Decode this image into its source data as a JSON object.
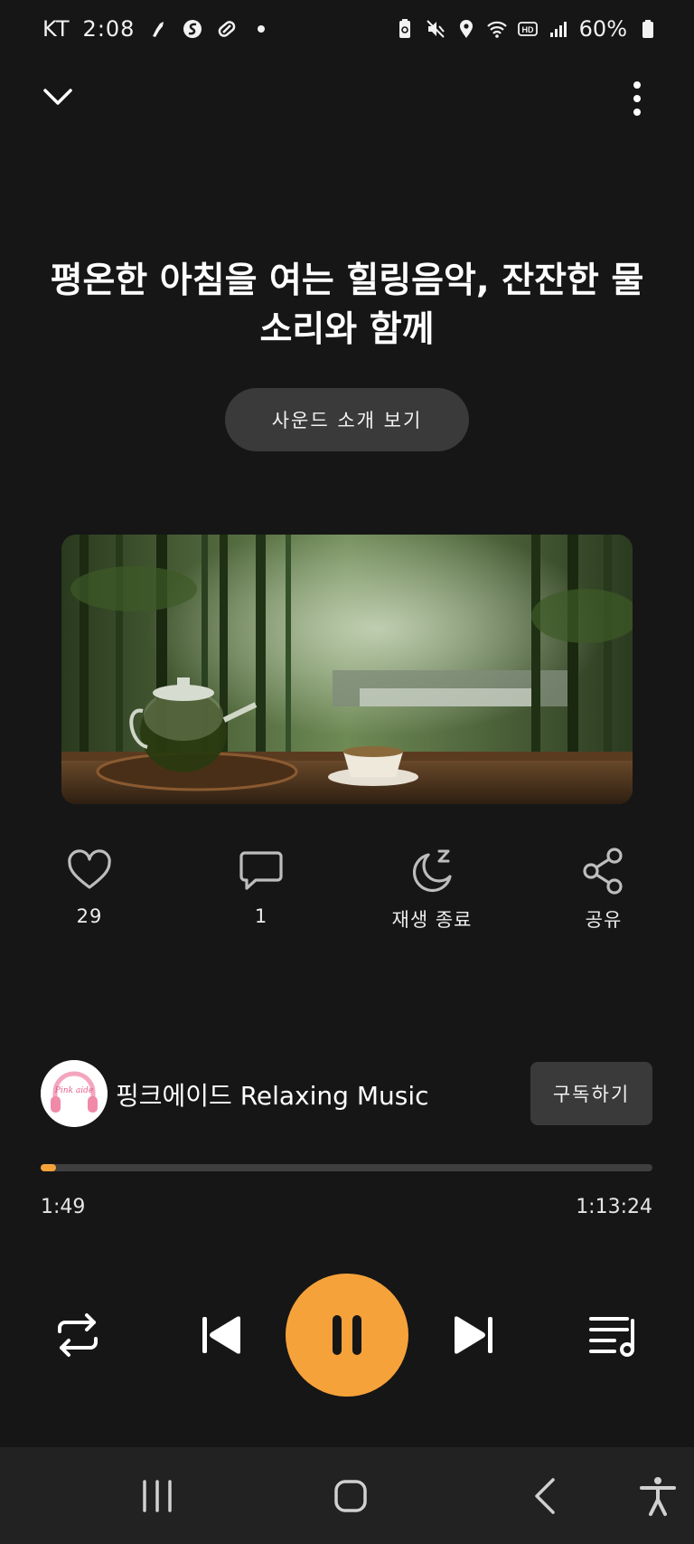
{
  "status_bar": {
    "carrier": "KT",
    "time": "2:08",
    "battery": "60%",
    "icons_left": [
      "running-app-icon",
      "s-app-icon",
      "link-app-icon",
      "dot-icon"
    ],
    "icons_right": [
      "battery-saver-icon",
      "mute-icon",
      "location-icon",
      "wifi-icon",
      "hd-icon",
      "signal-icon",
      "battery-icon"
    ]
  },
  "track": {
    "title": "평온한 아침을 여는 힐링음악, 잔잔한 물소리와 함께",
    "intro_button": "사운드 소개 보기"
  },
  "actions": {
    "like_count": "29",
    "comment_count": "1",
    "sleep_label": "재생 종료",
    "share_label": "공유"
  },
  "channel": {
    "name": "핑크에이드 Relaxing Music",
    "subscribe_label": "구독하기",
    "avatar_text": "Pink aide"
  },
  "playback": {
    "current_time": "1:49",
    "total_time": "1:13:24",
    "progress_fraction": 0.025,
    "state": "playing"
  },
  "colors": {
    "accent": "#f6a23a",
    "background": "#161616",
    "button_bg": "#3a3a3a"
  }
}
